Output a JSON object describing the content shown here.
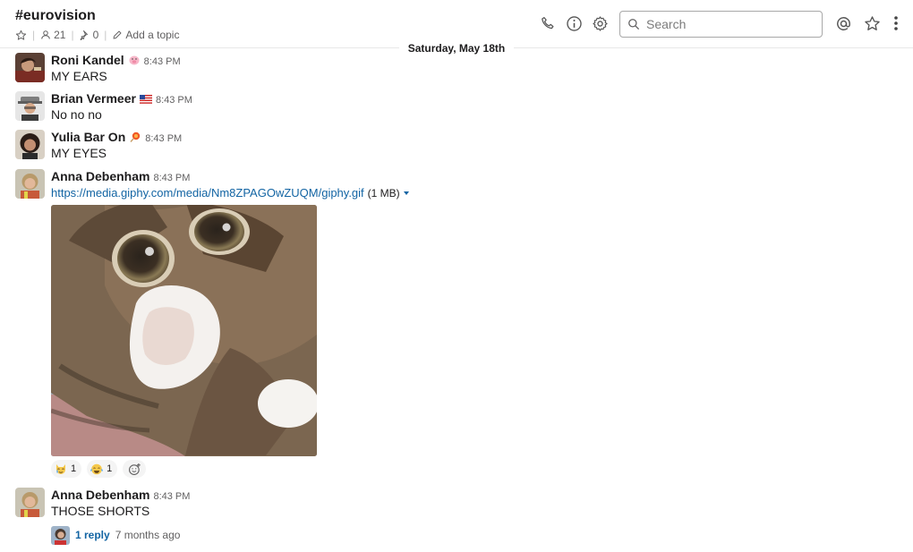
{
  "header": {
    "channel": "#eurovision",
    "members_count": "21",
    "pinned_count": "0",
    "add_topic": "Add a topic",
    "search_placeholder": "Search"
  },
  "date_divider": "Saturday, May 18th",
  "messages": [
    {
      "sender": "Roni Kandel",
      "status_emoji": "pig-icon",
      "time": "8:43 PM",
      "text": "MY EARS"
    },
    {
      "sender": "Brian Vermeer",
      "status_emoji": "us-flag-icon",
      "time": "8:43 PM",
      "text": "No no no"
    },
    {
      "sender": "Yulia Bar On",
      "status_emoji": "lollipop-icon",
      "time": "8:43 PM",
      "text": "MY EYES"
    },
    {
      "sender": "Anna Debenham",
      "time": "8:43 PM",
      "link": "https://media.giphy.com/media/Nm8ZPAGOwZUQM/giphy.gif",
      "file_size": "(1 MB)",
      "reactions": [
        {
          "emoji": "crying-cat-icon",
          "count": "1"
        },
        {
          "emoji": "laughing-crying-icon",
          "count": "1"
        }
      ]
    },
    {
      "sender": "Anna Debenham",
      "time": "8:43 PM",
      "text": "THOSE SHORTS",
      "thread": {
        "reply_label": "1 reply",
        "last_reply": "7 months ago"
      }
    }
  ],
  "colors": {
    "link": "#1264a3",
    "text": "#1d1c1d",
    "muted": "#616061"
  }
}
